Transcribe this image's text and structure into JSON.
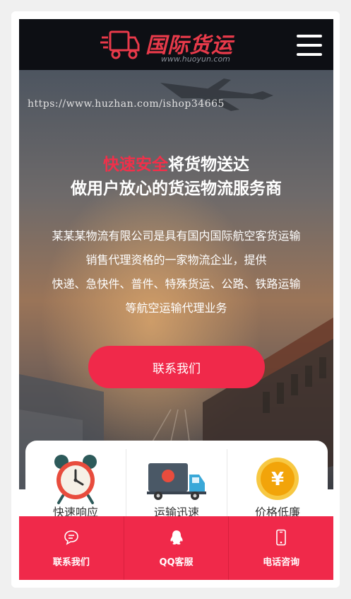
{
  "header": {
    "logo_title": "国际货运",
    "logo_url": "www.huoyun.com",
    "menu_icon": "hamburger-menu-icon"
  },
  "hero": {
    "watermark": "https://www.huzhan.com/ishop34665",
    "headline_highlight": "快速安全",
    "headline_rest": "将货物送达",
    "headline_line2": "做用户放心的货运物流服务商",
    "desc_lines": [
      "某某某物流有限公司是具有国内国际航空客货运输",
      "销售代理资格的一家物流企业，提供",
      "快递、急快件、普件、特殊货运、公路、铁路运输",
      "等航空运输代理业务"
    ],
    "contact_label": "联系我们"
  },
  "features": [
    {
      "label": "快速响应",
      "icon": "alarm-clock-icon"
    },
    {
      "label": "运输迅速",
      "icon": "delivery-truck-icon"
    },
    {
      "label": "价格低廉",
      "icon": "yen-coin-icon"
    }
  ],
  "bottom_nav": [
    {
      "label": "联系我们",
      "icon": "chat-bubble-icon"
    },
    {
      "label": "QQ客服",
      "icon": "qq-penguin-icon"
    },
    {
      "label": "电话咨询",
      "icon": "mobile-phone-icon"
    }
  ],
  "colors": {
    "accent": "#f0294a",
    "header_bg": "#0d0f14",
    "logo_red": "#e83a4a"
  }
}
